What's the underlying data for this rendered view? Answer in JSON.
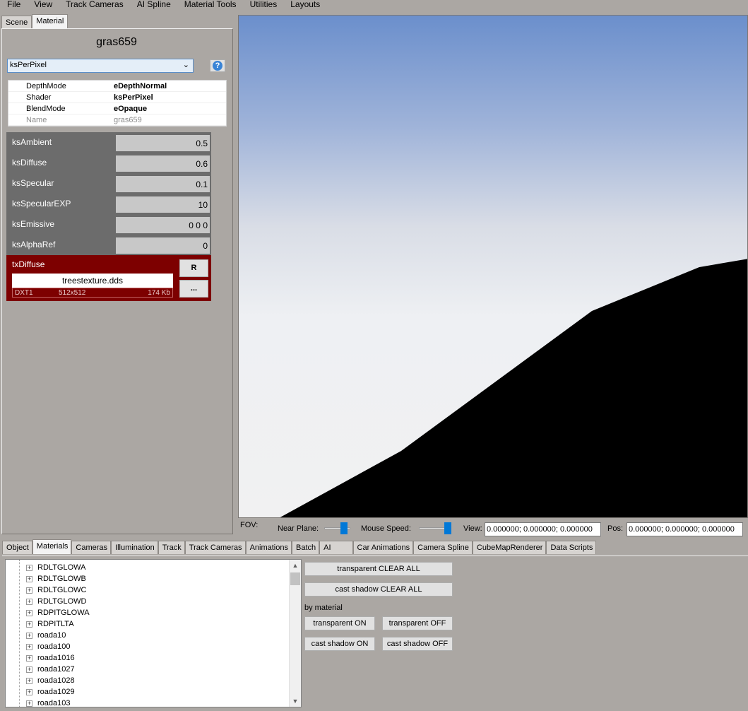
{
  "menu": [
    "File",
    "View",
    "Track Cameras",
    "AI Spline",
    "Material Tools",
    "Utilities",
    "Layouts"
  ],
  "left_tabs": [
    "Scene",
    "Material"
  ],
  "material": {
    "title": "gras659",
    "shader_select": "ksPerPixel",
    "help_label": "?",
    "properties": [
      {
        "key": "DepthMode",
        "value": "eDepthNormal"
      },
      {
        "key": "Shader",
        "value": "ksPerPixel"
      },
      {
        "key": "BlendMode",
        "value": "eOpaque"
      },
      {
        "key": "Name",
        "value": "gras659"
      }
    ],
    "params": [
      {
        "label": "ksAmbient",
        "value": "0.5"
      },
      {
        "label": "ksDiffuse",
        "value": "0.6"
      },
      {
        "label": "ksSpecular",
        "value": "0.1"
      },
      {
        "label": "ksSpecularEXP",
        "value": "10"
      },
      {
        "label": "ksEmissive",
        "value": "0 0 0"
      },
      {
        "label": "ksAlphaRef",
        "value": "0"
      }
    ],
    "texture": {
      "label": "txDiffuse",
      "file": "treestexture.dds",
      "format": "DXT1",
      "size": "512x512",
      "filesize": "174 Kb",
      "reload_label": "R",
      "browse_label": "..."
    }
  },
  "viewport_controls": {
    "fov_label": "FOV:",
    "near_label": "Near Plane:",
    "mouse_label": "Mouse Speed:",
    "view_label": "View:",
    "view_value": "0.000000; 0.000000; 0.000000",
    "pos_label": "Pos:",
    "pos_value": "0.000000; 0.000000; 0.000000",
    "near_plane_level": 0.85,
    "mouse_speed_level": 1.0
  },
  "bottom_tabs": [
    "Object",
    "Materials",
    "Cameras",
    "Illumination",
    "Track",
    "Track Cameras",
    "Animations",
    "Batch",
    "AI",
    "Car Animations",
    "Camera Spline",
    "CubeMapRenderer",
    "Data Scripts"
  ],
  "material_tree": [
    "RDLTGLOWA",
    "RDLTGLOWB",
    "RDLTGLOWC",
    "RDLTGLOWD",
    "RDPITGLOWA",
    "RDPITLTA",
    "roada10",
    "roada100",
    "roada1016",
    "roada1027",
    "roada1028",
    "roada1029",
    "roada103"
  ],
  "tree_expander": "+",
  "buttons": {
    "transparent_clear_all": "transparent CLEAR ALL",
    "cast_shadow_clear_all": "cast shadow CLEAR ALL",
    "by_material": "by material",
    "transparent_on": "transparent ON",
    "transparent_off": "transparent OFF",
    "cast_shadow_on": "cast shadow ON",
    "cast_shadow_off": "cast shadow OFF"
  },
  "colors": {
    "param_bg": "#6c6c6c",
    "texture_bg": "#7d0000",
    "slider_thumb": "#0078d7",
    "select_bg": "#e4eef8"
  }
}
